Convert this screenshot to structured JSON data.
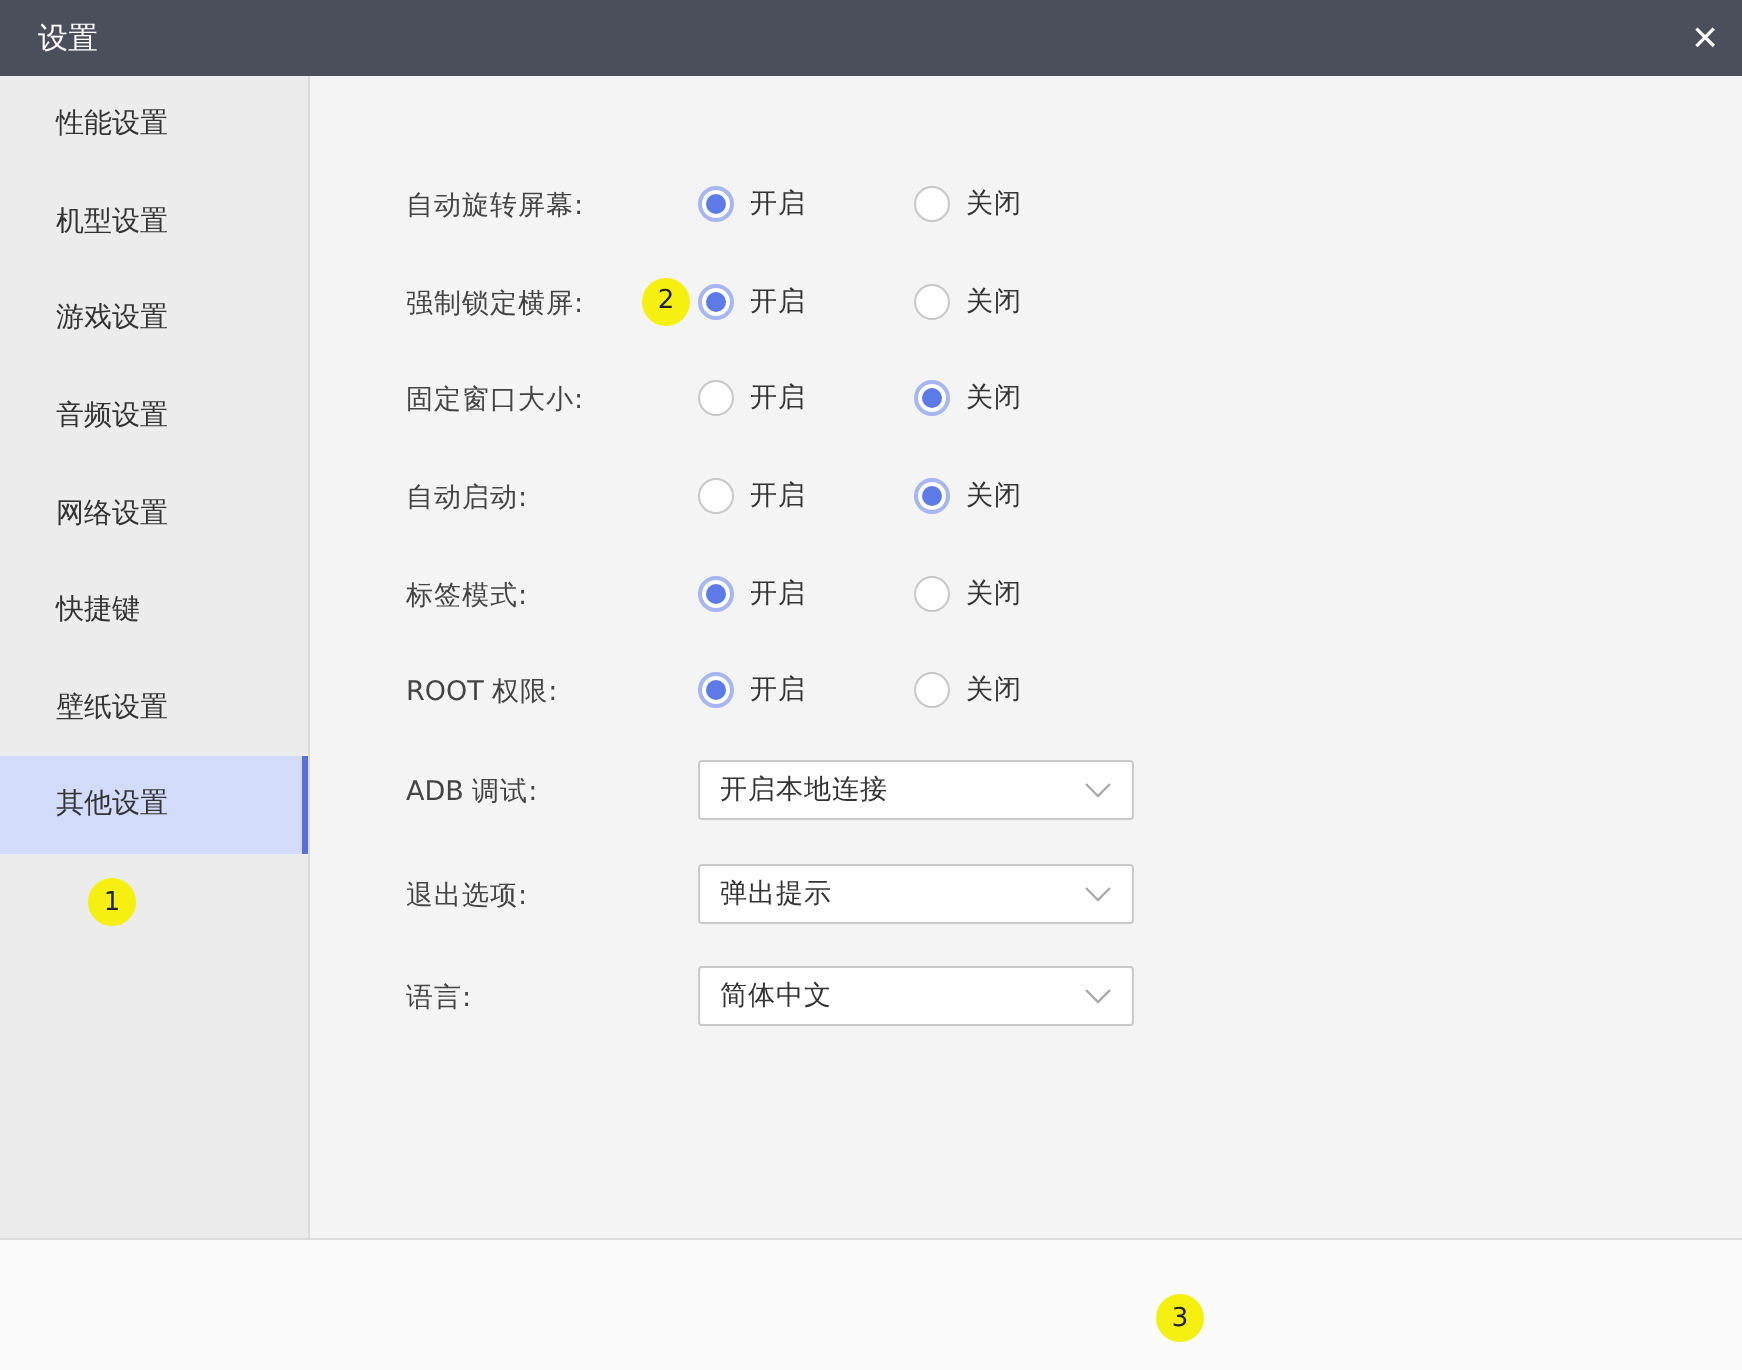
{
  "window": {
    "title": "设置",
    "close": "×"
  },
  "sidebar": {
    "items": [
      {
        "label": "性能设置",
        "selected": false
      },
      {
        "label": "机型设置",
        "selected": false
      },
      {
        "label": "游戏设置",
        "selected": false
      },
      {
        "label": "音频设置",
        "selected": false
      },
      {
        "label": "网络设置",
        "selected": false
      },
      {
        "label": "快捷键",
        "selected": false
      },
      {
        "label": "壁纸设置",
        "selected": false
      },
      {
        "label": "其他设置",
        "selected": true
      }
    ],
    "badge": "1"
  },
  "settings": [
    {
      "kind": "radio",
      "label": "自动旋转屏幕:",
      "options": [
        {
          "label": "开启",
          "selected": true
        },
        {
          "label": "关闭",
          "selected": false
        }
      ]
    },
    {
      "kind": "radio",
      "label": "强制锁定横屏:",
      "badge": "2",
      "options": [
        {
          "label": "开启",
          "selected": true
        },
        {
          "label": "关闭",
          "selected": false
        }
      ]
    },
    {
      "kind": "radio",
      "label": "固定窗口大小:",
      "options": [
        {
          "label": "开启",
          "selected": false
        },
        {
          "label": "关闭",
          "selected": true
        }
      ]
    },
    {
      "kind": "radio",
      "label": "自动启动:",
      "options": [
        {
          "label": "开启",
          "selected": false
        },
        {
          "label": "关闭",
          "selected": true
        }
      ]
    },
    {
      "kind": "radio",
      "label": "标签模式:",
      "options": [
        {
          "label": "开启",
          "selected": true
        },
        {
          "label": "关闭",
          "selected": false
        }
      ]
    },
    {
      "kind": "radio",
      "label": "ROOT 权限:",
      "options": [
        {
          "label": "开启",
          "selected": true
        },
        {
          "label": "关闭",
          "selected": false
        }
      ]
    },
    {
      "kind": "select",
      "label": "ADB 调试:",
      "value": "开启本地连接"
    },
    {
      "kind": "select",
      "label": "退出选项:",
      "value": "弹出提示"
    },
    {
      "kind": "select",
      "label": "语言:",
      "value": "简体中文"
    }
  ],
  "footer": {
    "badge": "3"
  }
}
